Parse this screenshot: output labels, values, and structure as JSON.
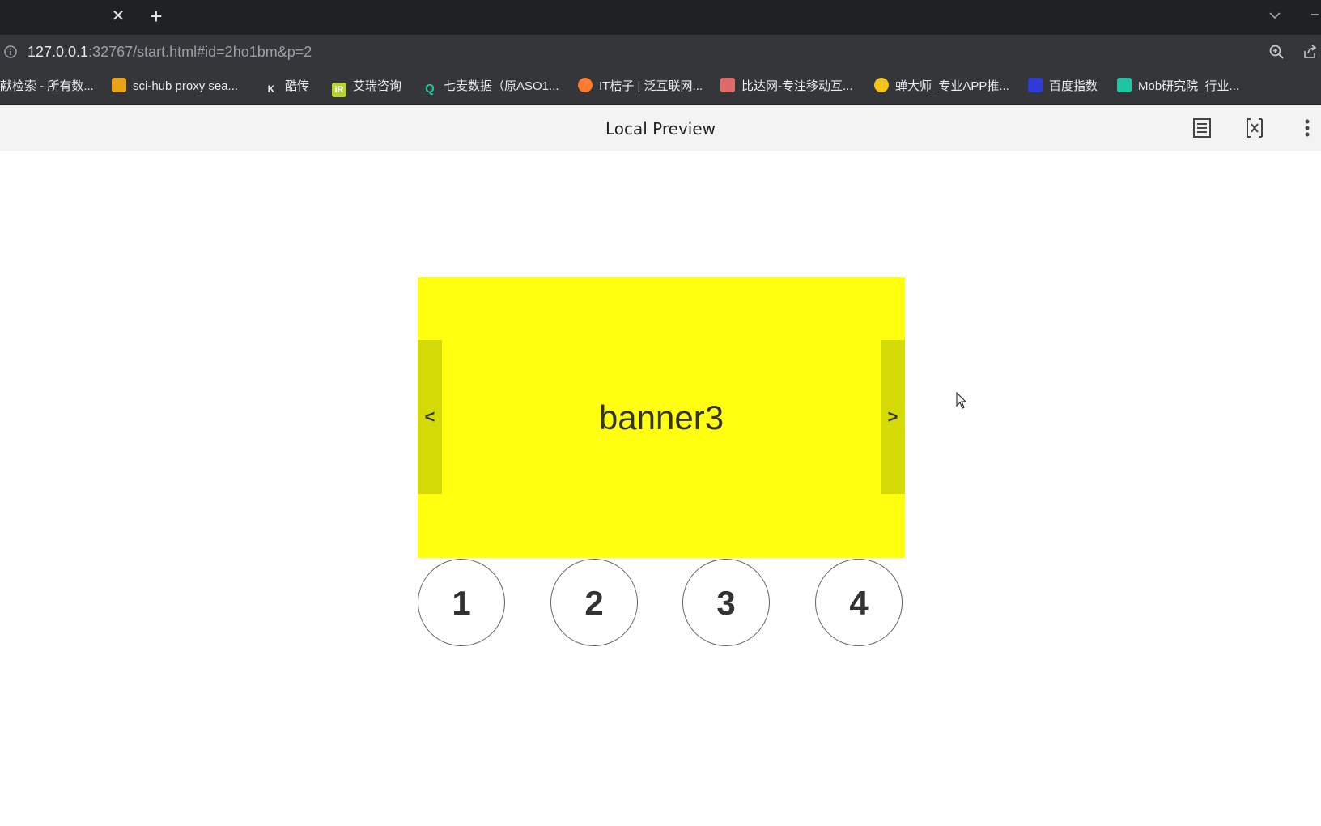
{
  "browser": {
    "tab_close_glyph": "✕",
    "new_tab_glyph": "+",
    "window_min_glyph": "–",
    "address_host": "127.0.0.1",
    "address_rest": ":32767/start.html#id=2ho1bm&p=2"
  },
  "bookmarks": [
    {
      "label": "献检索 - 所有数...",
      "icon": "doc-icon",
      "icon_glyph": "",
      "color": "#35363a"
    },
    {
      "label": "sci-hub proxy sea...",
      "icon": "scihub-icon",
      "icon_glyph": "",
      "color": "#e8a317"
    },
    {
      "label": "酷传",
      "icon": "kuchuan-icon",
      "icon_glyph": "K",
      "color": "#35363a"
    },
    {
      "label": "艾瑞咨询",
      "icon": "iresearch-icon",
      "icon_glyph": "iR",
      "color": "#b5d334"
    },
    {
      "label": "七麦数据（原ASO1...",
      "icon": "qimai-icon",
      "icon_glyph": "Q",
      "color": "#35363a"
    },
    {
      "label": "IT桔子 | 泛互联网...",
      "icon": "itjuzi-icon",
      "icon_glyph": "",
      "color": "#ff7a2e"
    },
    {
      "label": "比达网-专注移动互...",
      "icon": "bigdata-icon",
      "icon_glyph": "",
      "color": "#e06a6a"
    },
    {
      "label": "蝉大师_专业APP推...",
      "icon": "chandashi-icon",
      "icon_glyph": "",
      "color": "#f2c31a"
    },
    {
      "label": "百度指数",
      "icon": "baidu-icon",
      "icon_glyph": "",
      "color": "#2f3ad8"
    },
    {
      "label": "Mob研究院_行业...",
      "icon": "mob-icon",
      "icon_glyph": "",
      "color": "#1fc4a2"
    }
  ],
  "preview": {
    "title": "Local Preview"
  },
  "banner": {
    "text": "banner3",
    "prev_label": "<",
    "next_label": ">",
    "color": "#ffff0f",
    "arrow_color": "#d4da06",
    "active_index": 3
  },
  "indicators": [
    "1",
    "2",
    "3",
    "4"
  ]
}
